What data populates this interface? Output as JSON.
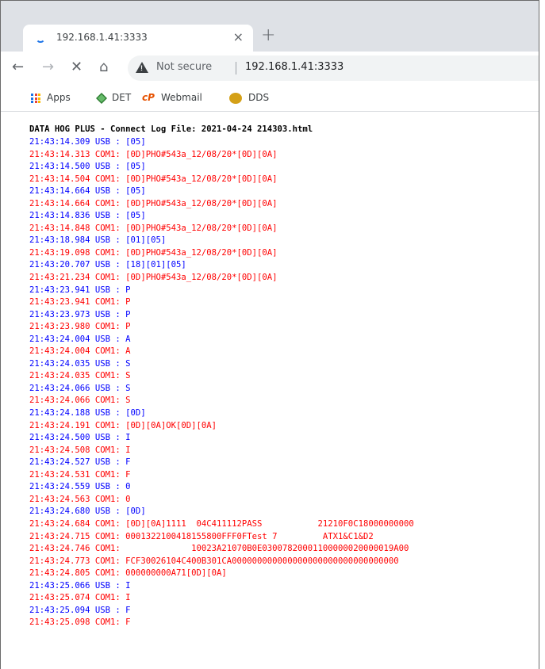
{
  "browser": {
    "tab_title": "192.168.1.41:3333",
    "tab_close": "×",
    "new_tab": "+",
    "nav": {
      "back": "←",
      "forward": "→",
      "stop": "✕",
      "home": "⌂"
    },
    "security_label": "Not secure",
    "url": "192.168.1.41:3333",
    "bookmarks": [
      {
        "label": "Apps",
        "icon": "apps-grid-icon"
      },
      {
        "label": "DET",
        "icon": "det-icon"
      },
      {
        "label": "Webmail",
        "icon": "cpanel-icon"
      },
      {
        "label": "DDS",
        "icon": "dds-icon"
      }
    ]
  },
  "page": {
    "title": "DATA HOG PLUS - Connect Log File: 2021-04-24 214303.html",
    "lines": [
      {
        "source": "usb",
        "text": "21:43:14.309 USB : [05]"
      },
      {
        "source": "com",
        "text": "21:43:14.313 COM1: [0D]PHO#543a_12/08/20*[0D][0A]"
      },
      {
        "source": "usb",
        "text": "21:43:14.500 USB : [05]"
      },
      {
        "source": "com",
        "text": "21:43:14.504 COM1: [0D]PHO#543a_12/08/20*[0D][0A]"
      },
      {
        "source": "usb",
        "text": "21:43:14.664 USB : [05]"
      },
      {
        "source": "com",
        "text": "21:43:14.664 COM1: [0D]PHO#543a_12/08/20*[0D][0A]"
      },
      {
        "source": "usb",
        "text": "21:43:14.836 USB : [05]"
      },
      {
        "source": "com",
        "text": "21:43:14.848 COM1: [0D]PHO#543a_12/08/20*[0D][0A]"
      },
      {
        "source": "usb",
        "text": "21:43:18.984 USB : [01][05]"
      },
      {
        "source": "com",
        "text": "21:43:19.098 COM1: [0D]PHO#543a_12/08/20*[0D][0A]"
      },
      {
        "source": "usb",
        "text": "21:43:20.707 USB : [18][01][05]"
      },
      {
        "source": "com",
        "text": "21:43:21.234 COM1: [0D]PHO#543a_12/08/20*[0D][0A]"
      },
      {
        "source": "usb",
        "text": "21:43:23.941 USB : P"
      },
      {
        "source": "com",
        "text": "21:43:23.941 COM1: P"
      },
      {
        "source": "usb",
        "text": "21:43:23.973 USB : P"
      },
      {
        "source": "com",
        "text": "21:43:23.980 COM1: P"
      },
      {
        "source": "usb",
        "text": "21:43:24.004 USB : A"
      },
      {
        "source": "com",
        "text": "21:43:24.004 COM1: A"
      },
      {
        "source": "usb",
        "text": "21:43:24.035 USB : S"
      },
      {
        "source": "com",
        "text": "21:43:24.035 COM1: S"
      },
      {
        "source": "usb",
        "text": "21:43:24.066 USB : S"
      },
      {
        "source": "com",
        "text": "21:43:24.066 COM1: S"
      },
      {
        "source": "usb",
        "text": "21:43:24.188 USB : [0D]"
      },
      {
        "source": "com",
        "text": "21:43:24.191 COM1: [0D][0A]OK[0D][0A]"
      },
      {
        "source": "usb",
        "text": "21:43:24.500 USB : I"
      },
      {
        "source": "com",
        "text": "21:43:24.508 COM1: I"
      },
      {
        "source": "usb",
        "text": "21:43:24.527 USB : F"
      },
      {
        "source": "com",
        "text": "21:43:24.531 COM1: F"
      },
      {
        "source": "usb",
        "text": "21:43:24.559 USB : 0"
      },
      {
        "source": "com",
        "text": "21:43:24.563 COM1: 0"
      },
      {
        "source": "usb",
        "text": "21:43:24.680 USB : [0D]"
      },
      {
        "source": "com",
        "text": "21:43:24.684 COM1: [0D][0A]1111  04C411112PASS           21210F0C18000000000"
      },
      {
        "source": "com",
        "text": "21:43:24.715 COM1: 0001322100418155800FFF0FTest 7         ATX1&C1&D2"
      },
      {
        "source": "com",
        "text": "21:43:24.746 COM1:              10023A21070B0E03007820001100000020000019A00"
      },
      {
        "source": "com",
        "text": "21:43:24.773 COM1: FCF30026104C400B301CA000000000000000000000000000000000"
      },
      {
        "source": "com",
        "text": "21:43:24.805 COM1: 000000000A71[0D][0A]"
      },
      {
        "source": "usb",
        "text": "21:43:25.066 USB : I"
      },
      {
        "source": "com",
        "text": "21:43:25.074 COM1: I"
      },
      {
        "source": "usb",
        "text": "21:43:25.094 USB : F"
      },
      {
        "source": "com",
        "text": "21:43:25.098 COM1: F"
      }
    ]
  }
}
